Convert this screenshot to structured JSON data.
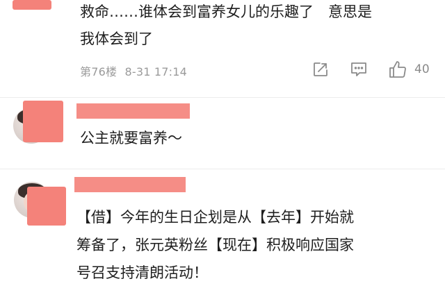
{
  "comments": [
    {
      "text_lines": [
        "救命……谁体会到富养女儿的乐趣了　意思是",
        "我体会到了"
      ],
      "floor": "第76楼",
      "time": "8-31 17:14",
      "likes": "40"
    },
    {
      "text_lines": [
        "公主就要富养～"
      ]
    },
    {
      "text_lines": [
        "【借】今年的生日企划是从【去年】开始就",
        "筹备了，张元英粉丝【现在】积极响应国家",
        "号召支持清朗活动！"
      ]
    }
  ],
  "icons": {
    "share": "share-icon",
    "reply": "comment-icon",
    "like": "thumbs-up-icon"
  },
  "colors": {
    "mask": "#f4827a",
    "meta_text": "#9a9a9a",
    "divider": "#ececec"
  }
}
